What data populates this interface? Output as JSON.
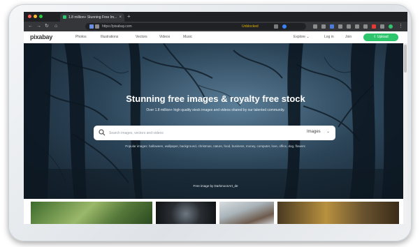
{
  "browser": {
    "tab_title": "1.8 million+ Stunning Free Im...",
    "tab_close": "×",
    "new_tab": "+",
    "url": "https://pixabay.com",
    "status": "Unblocked"
  },
  "site": {
    "logo": "pixabay",
    "nav": [
      "Photos",
      "Illustrations",
      "Vectors",
      "Videos",
      "Music"
    ],
    "explore": "Explore ⌄",
    "login": "Log in",
    "join": "Join",
    "upload": "⇧ Upload"
  },
  "hero": {
    "title": "Stunning free images & royalty free stock",
    "subtitle": "Over 1.8 million+ high quality stock images and videos shared by our talented community.",
    "search_placeholder": "Search images, vectors and videos",
    "search_type": "Images",
    "popular": "Popular images: halloween, wallpaper, background, christmas, nature, food, business, money, computer, love, office, dog, flowers",
    "credit": "Free image by DarkmoonArt_de"
  },
  "colors": {
    "accent": "#2ec66d"
  }
}
